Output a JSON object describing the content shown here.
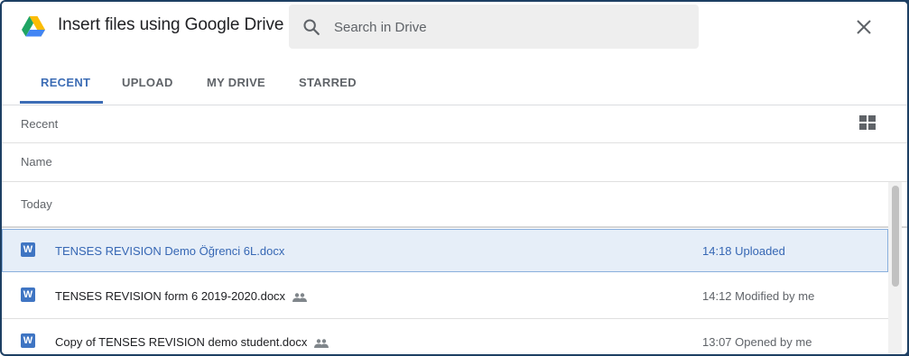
{
  "header": {
    "title": "Insert files using Google Drive",
    "search_placeholder": "Search in Drive",
    "logo_icon": "google-drive-icon",
    "close_icon": "close-icon",
    "search_icon": "search-icon"
  },
  "tabs": [
    {
      "label": "RECENT",
      "active": true
    },
    {
      "label": "UPLOAD",
      "active": false
    },
    {
      "label": "MY DRIVE",
      "active": false
    },
    {
      "label": "STARRED",
      "active": false
    }
  ],
  "view": {
    "section_title": "Recent",
    "column_header": "Name",
    "group_label": "Today",
    "view_toggle_icon": "grid-view-icon"
  },
  "files": [
    {
      "icon": "W",
      "name": "TENSES REVISION Demo Öğrenci 6L.docx",
      "shared": false,
      "time": "14:18 Uploaded",
      "selected": true
    },
    {
      "icon": "W",
      "name": "TENSES REVISION form 6 2019-2020.docx",
      "shared": true,
      "time": "14:12 Modified by me",
      "selected": false
    },
    {
      "icon": "W",
      "name": "Copy of TENSES REVISION demo student.docx",
      "shared": true,
      "time": "13:07 Opened by me",
      "selected": false
    }
  ],
  "colors": {
    "accent": "#3d6db5",
    "selected_bg": "#e6eef8",
    "word_icon": "#3f75c3",
    "frame": "#1d3f63"
  }
}
